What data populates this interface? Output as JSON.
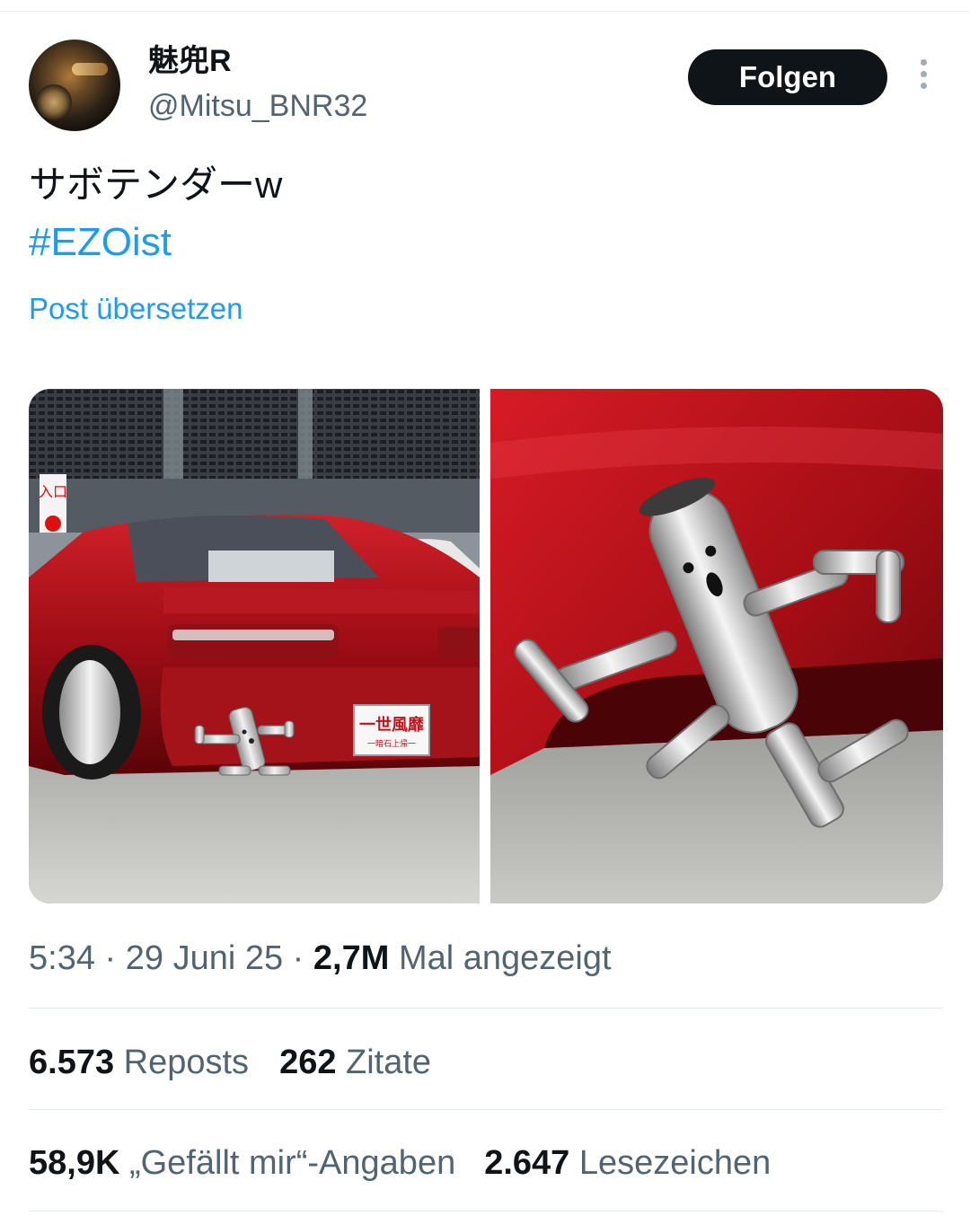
{
  "author": {
    "display_name": "魅兜R",
    "handle": "@Mitsu_BNR32"
  },
  "follow_label": "Folgen",
  "tweet": {
    "text": "サボテンダーw",
    "hashtag": "#EZOist",
    "translate_label": "Post übersetzen"
  },
  "media": {
    "left_plate_text": "一世風靡",
    "left_plate_sub": "一暗石上帰一",
    "left_sign_text": "入口"
  },
  "meta": {
    "time": "5:34",
    "sep1": " · ",
    "date": "29 Juni 25",
    "sep2": " · ",
    "views": "2,7M",
    "views_label": " Mal angezeigt"
  },
  "stats": {
    "reposts_count": "6.573",
    "reposts_label": " Reposts",
    "quotes_count": "262",
    "quotes_label": " Zitate",
    "likes_count": "58,9K",
    "likes_label": " „Gefällt mir“-Angaben",
    "bookmarks_count": "2.647",
    "bookmarks_label": " Lesezeichen"
  },
  "colors": {
    "link": "#1d9bf0",
    "secondary_text": "#536471",
    "primary_text": "#0f1419",
    "button_bg": "#0f1419"
  }
}
